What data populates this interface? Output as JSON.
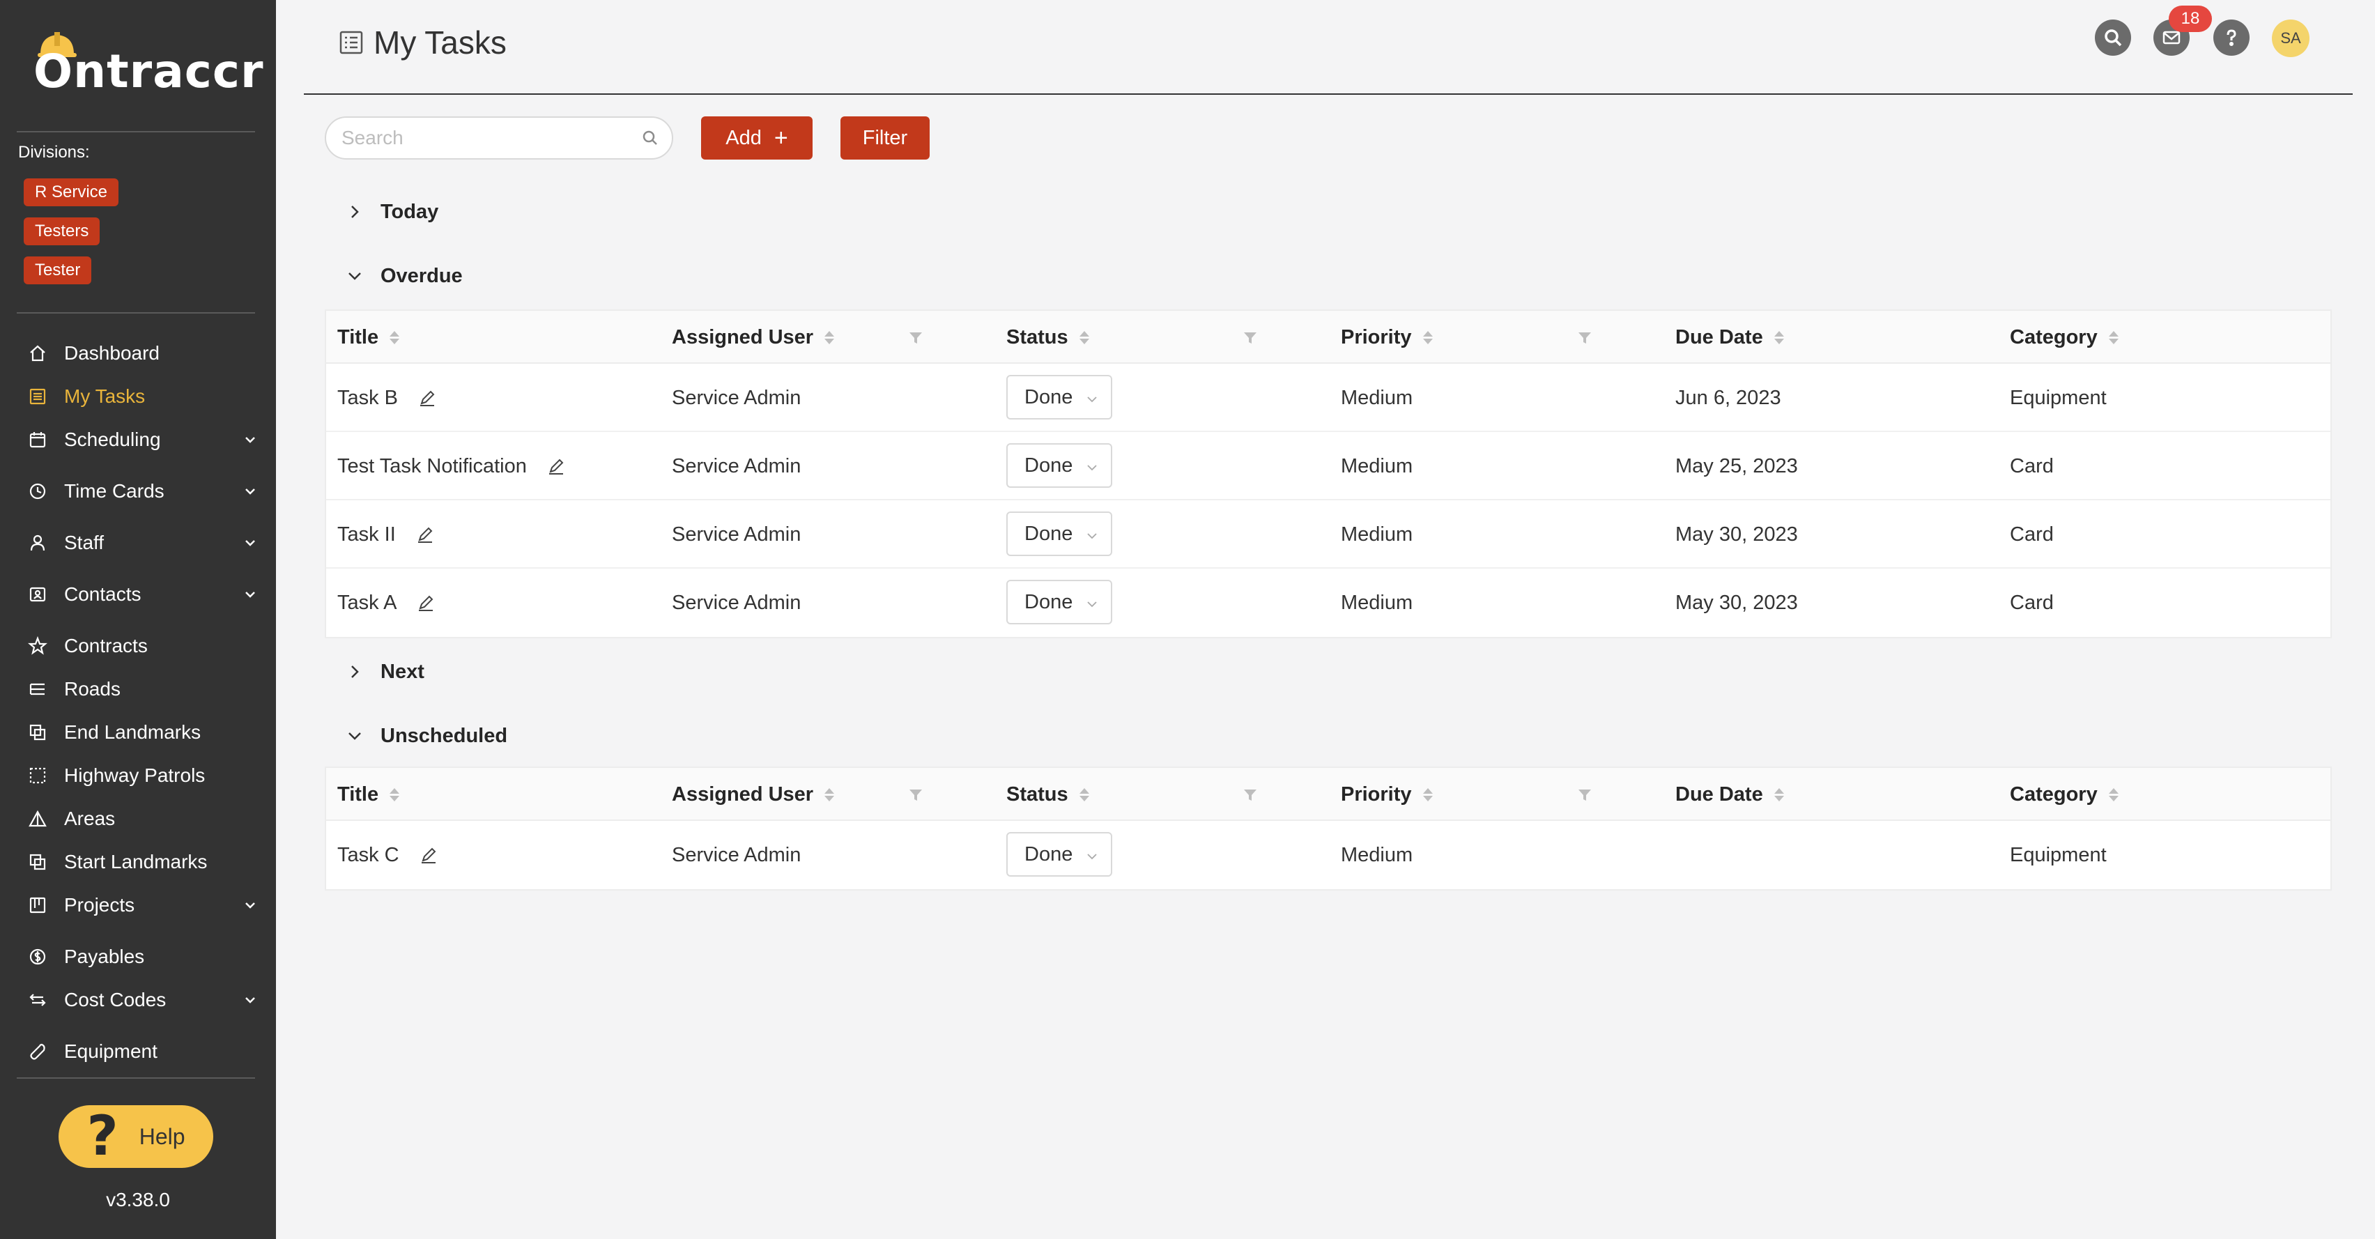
{
  "app": {
    "logo_text": "Ontraccr",
    "version": "v3.38.0",
    "help_label": "Help",
    "help_glyph": "?"
  },
  "divisions": {
    "label": "Divisions:",
    "tags": [
      "R Service",
      "Testers",
      "Tester"
    ]
  },
  "nav": [
    {
      "label": "Dashboard",
      "icon": "home-icon",
      "expandable": false,
      "active": false
    },
    {
      "label": "My Tasks",
      "icon": "task-list-icon",
      "expandable": false,
      "active": true
    },
    {
      "label": "Scheduling",
      "icon": "calendar-icon",
      "expandable": true,
      "active": false
    },
    {
      "label": "Time Cards",
      "icon": "clock-icon",
      "expandable": true,
      "active": false
    },
    {
      "label": "Staff",
      "icon": "user-icon",
      "expandable": true,
      "active": false
    },
    {
      "label": "Contacts",
      "icon": "contacts-icon",
      "expandable": true,
      "active": false
    },
    {
      "label": "Contracts",
      "icon": "star-icon",
      "expandable": false,
      "active": false
    },
    {
      "label": "Roads",
      "icon": "list-icon",
      "expandable": false,
      "active": false
    },
    {
      "label": "End Landmarks",
      "icon": "copy-icon",
      "expandable": false,
      "active": false
    },
    {
      "label": "Highway Patrols",
      "icon": "dashed-box-icon",
      "expandable": false,
      "active": false
    },
    {
      "label": "Areas",
      "icon": "triangle-icon",
      "expandable": false,
      "active": false
    },
    {
      "label": "Start Landmarks",
      "icon": "copy-icon",
      "expandable": false,
      "active": false
    },
    {
      "label": "Projects",
      "icon": "project-icon",
      "expandable": true,
      "active": false
    },
    {
      "label": "Payables",
      "icon": "dollar-icon",
      "expandable": false,
      "active": false
    },
    {
      "label": "Cost Codes",
      "icon": "swap-icon",
      "expandable": true,
      "active": false
    },
    {
      "label": "Equipment",
      "icon": "wrench-icon",
      "expandable": false,
      "active": false
    }
  ],
  "header": {
    "title": "My Tasks",
    "notification_count": "18",
    "avatar_initials": "SA"
  },
  "toolbar": {
    "search_placeholder": "Search",
    "add_label": "Add",
    "add_plus": "+",
    "filter_label": "Filter"
  },
  "columns": [
    "Title",
    "Assigned User",
    "Status",
    "Priority",
    "Due Date",
    "Category"
  ],
  "sections": {
    "today": {
      "label": "Today",
      "expanded": false
    },
    "overdue": {
      "label": "Overdue",
      "expanded": true,
      "rows": [
        {
          "title": "Task B",
          "user": "Service Admin",
          "status": "Done",
          "priority": "Medium",
          "due": "Jun 6, 2023",
          "category": "Equipment"
        },
        {
          "title": "Test Task Notification",
          "user": "Service Admin",
          "status": "Done",
          "priority": "Medium",
          "due": "May 25, 2023",
          "category": "Card"
        },
        {
          "title": "Task II",
          "user": "Service Admin",
          "status": "Done",
          "priority": "Medium",
          "due": "May 30, 2023",
          "category": "Card"
        },
        {
          "title": "Task A",
          "user": "Service Admin",
          "status": "Done",
          "priority": "Medium",
          "due": "May 30, 2023",
          "category": "Card"
        }
      ]
    },
    "next": {
      "label": "Next",
      "expanded": false
    },
    "unscheduled": {
      "label": "Unscheduled",
      "expanded": true,
      "rows": [
        {
          "title": "Task C",
          "user": "Service Admin",
          "status": "Done",
          "priority": "Medium",
          "due": "",
          "category": "Equipment"
        }
      ]
    }
  },
  "colors": {
    "sidebar_bg": "#333333",
    "accent": "#c2391b",
    "active_nav": "#e9b43b",
    "help_bg": "#f6c34a",
    "badge": "#e5473f"
  }
}
